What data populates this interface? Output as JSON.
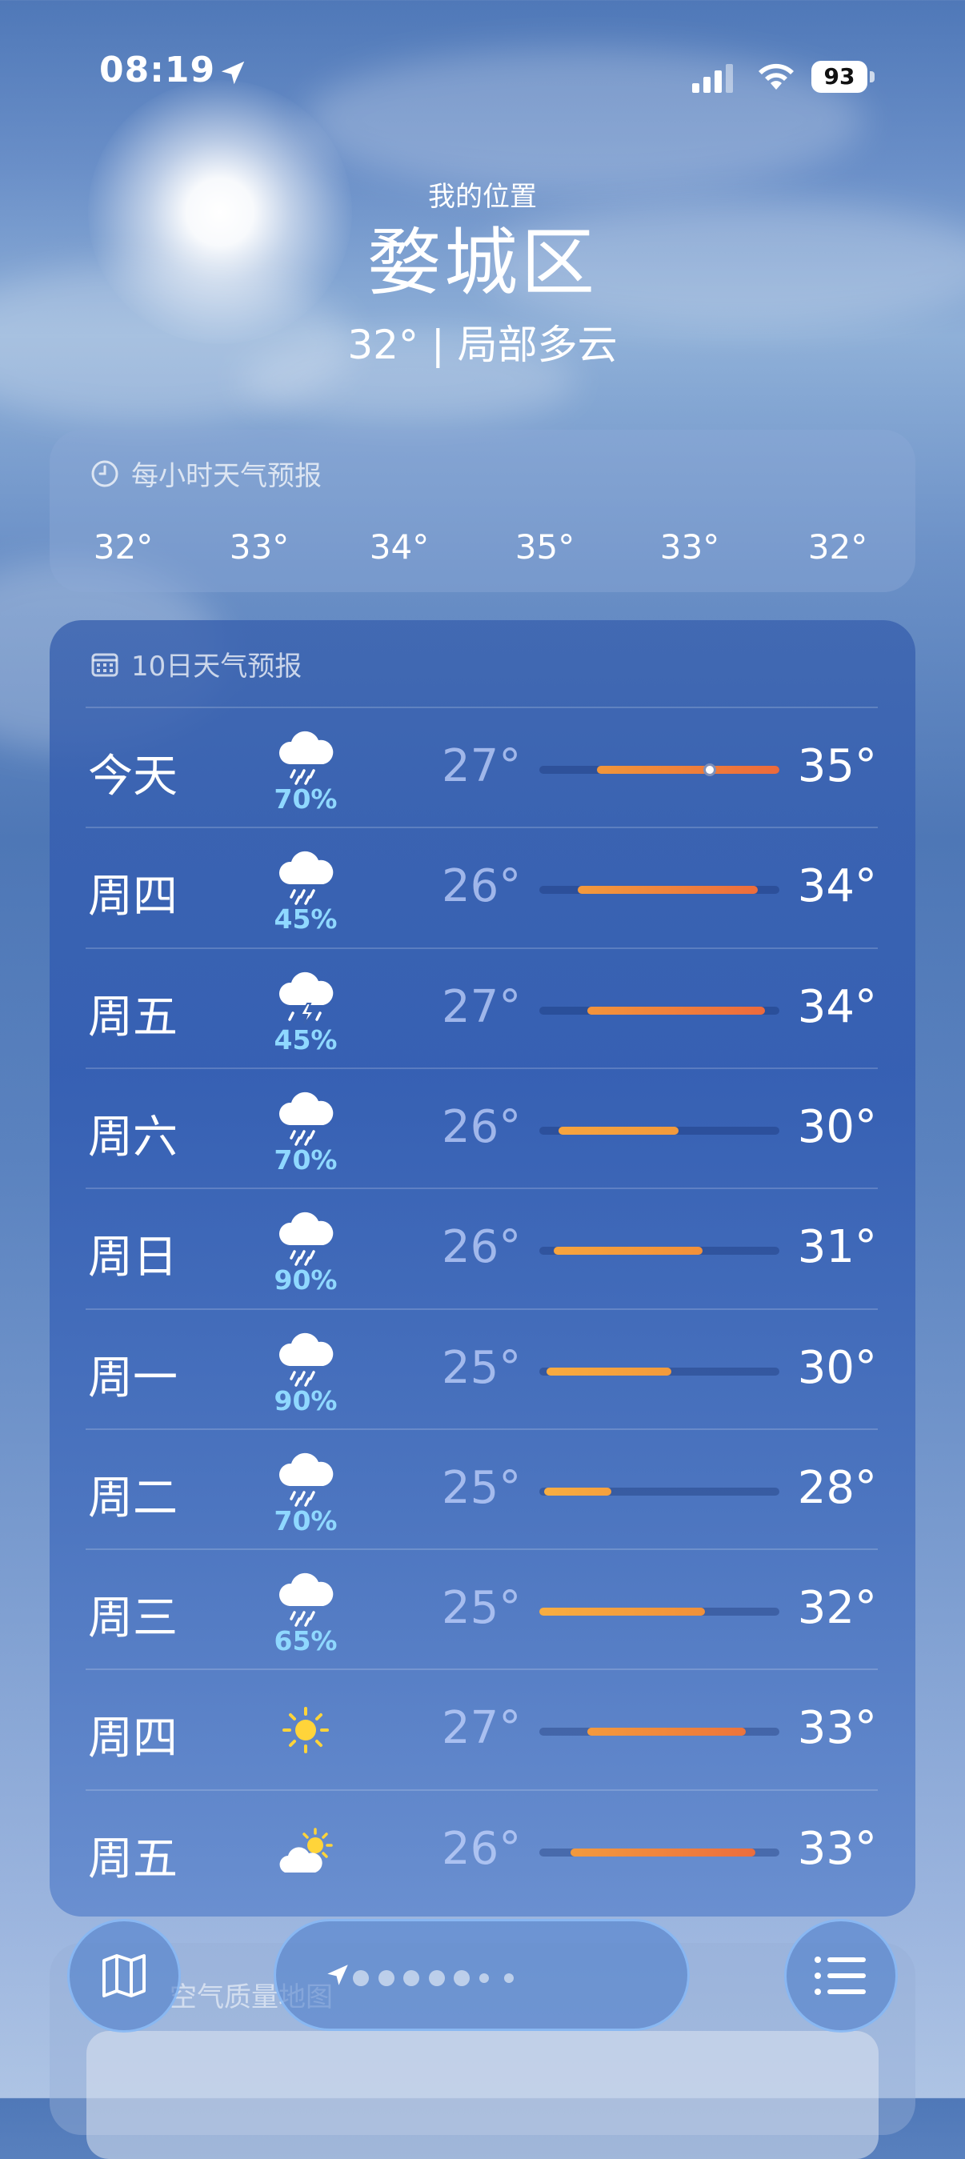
{
  "status_bar": {
    "time": "08:19",
    "battery": "93"
  },
  "header": {
    "subtitle": "我的位置",
    "city": "婺城区",
    "condition": "32° | 局部多云"
  },
  "hourly": {
    "title": "每小时天气预报",
    "temps": [
      "32°",
      "33°",
      "34°",
      "35°",
      "33°",
      "32°"
    ]
  },
  "daily": {
    "title": "10日天气预报",
    "days": [
      {
        "name": "今天",
        "icon": "rain-cloud-icon",
        "precip": "70%",
        "low": "27°",
        "high": "35°",
        "bar_from": 0.24,
        "bar_to": 1.0,
        "current": 0.71,
        "color_from": "#f1963a",
        "color_to": "#ec6a3c"
      },
      {
        "name": "周四",
        "icon": "rain-cloud-icon",
        "precip": "45%",
        "low": "26°",
        "high": "34°",
        "bar_from": 0.16,
        "bar_to": 0.91,
        "color_from": "#f39a3d",
        "color_to": "#ec6d3d"
      },
      {
        "name": "周五",
        "icon": "thunderstorm-icon",
        "precip": "45%",
        "low": "27°",
        "high": "34°",
        "bar_from": 0.2,
        "bar_to": 0.94,
        "color_from": "#f3943c",
        "color_to": "#ec6a3d"
      },
      {
        "name": "周六",
        "icon": "rain-cloud-icon",
        "precip": "70%",
        "low": "26°",
        "high": "30°",
        "bar_from": 0.08,
        "bar_to": 0.58,
        "color_from": "#f6a43e",
        "color_to": "#f29a3c"
      },
      {
        "name": "周日",
        "icon": "rain-cloud-icon",
        "precip": "90%",
        "low": "26°",
        "high": "31°",
        "bar_from": 0.06,
        "bar_to": 0.68,
        "color_from": "#f6a43e",
        "color_to": "#f29039"
      },
      {
        "name": "周一",
        "icon": "rain-cloud-icon",
        "precip": "90%",
        "low": "25°",
        "high": "30°",
        "bar_from": 0.03,
        "bar_to": 0.55,
        "color_from": "#f8ab40",
        "color_to": "#f29a3c"
      },
      {
        "name": "周二",
        "icon": "rain-cloud-icon",
        "precip": "70%",
        "low": "25°",
        "high": "28°",
        "bar_from": 0.02,
        "bar_to": 0.3,
        "color_from": "#f8ae42",
        "color_to": "#f5a03d"
      },
      {
        "name": "周三",
        "icon": "rain-cloud-icon",
        "precip": "65%",
        "low": "25°",
        "high": "32°",
        "bar_from": 0.0,
        "bar_to": 0.69,
        "color_from": "#f8ae42",
        "color_to": "#f0903a"
      },
      {
        "name": "周四",
        "icon": "sun-icon",
        "precip": "",
        "low": "27°",
        "high": "33°",
        "bar_from": 0.2,
        "bar_to": 0.86,
        "color_from": "#f39a3d",
        "color_to": "#ec743c"
      },
      {
        "name": "周五",
        "icon": "partly-sunny-icon",
        "precip": "",
        "low": "26°",
        "high": "33°",
        "bar_from": 0.13,
        "bar_to": 0.9,
        "color_from": "#f39a3d",
        "color_to": "#ec6d3d"
      }
    ]
  },
  "next_card": {
    "title": "空气质量地图"
  },
  "pager": {
    "dots": 7
  }
}
